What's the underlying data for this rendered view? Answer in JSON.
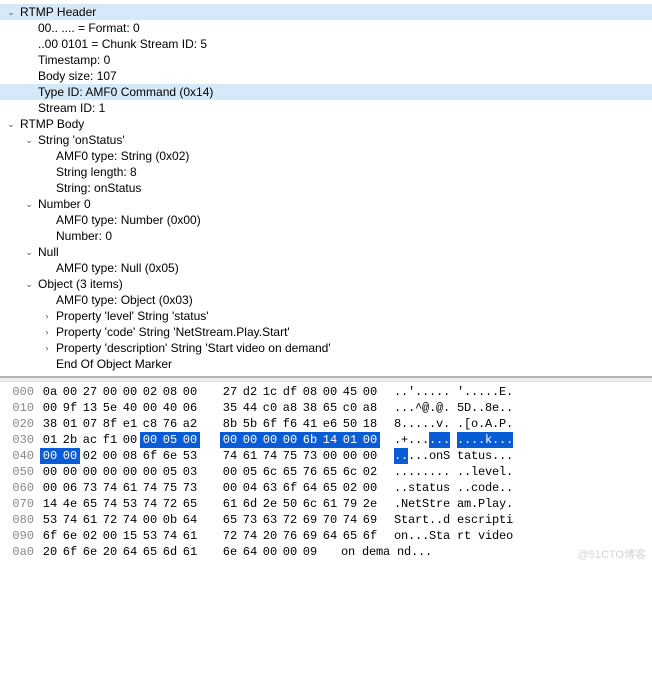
{
  "tree": [
    {
      "indent": 1,
      "caret": "v",
      "text": "RTMP Header",
      "sel": "header",
      "interact": true,
      "name": "rtmp-header-node"
    },
    {
      "indent": 2,
      "caret": "",
      "text": "00.. .... = Format: 0",
      "interact": true,
      "name": "format-field"
    },
    {
      "indent": 2,
      "caret": "",
      "text": "..00 0101 = Chunk Stream ID: 5",
      "interact": true,
      "name": "chunk-stream-id-field"
    },
    {
      "indent": 2,
      "caret": "",
      "text": "Timestamp: 0",
      "interact": true,
      "name": "timestamp-field"
    },
    {
      "indent": 2,
      "caret": "",
      "text": "Body size: 107",
      "interact": true,
      "name": "body-size-field"
    },
    {
      "indent": 2,
      "caret": "",
      "text": "Type ID: AMF0 Command (0x14)",
      "sel": "field",
      "interact": true,
      "name": "type-id-field"
    },
    {
      "indent": 2,
      "caret": "",
      "text": "Stream ID: 1",
      "interact": true,
      "name": "stream-id-field"
    },
    {
      "indent": 1,
      "caret": "v",
      "text": "RTMP Body",
      "interact": true,
      "name": "rtmp-body-node"
    },
    {
      "indent": 2,
      "caret": "v",
      "text": "String 'onStatus'",
      "interact": true,
      "name": "string-onstatus-node"
    },
    {
      "indent": 3,
      "caret": "",
      "text": "AMF0 type: String (0x02)",
      "interact": true,
      "name": "amf0-string-type"
    },
    {
      "indent": 3,
      "caret": "",
      "text": "String length: 8",
      "interact": true,
      "name": "string-length-field"
    },
    {
      "indent": 3,
      "caret": "",
      "text": "String: onStatus",
      "interact": true,
      "name": "string-value-field"
    },
    {
      "indent": 2,
      "caret": "v",
      "text": "Number 0",
      "interact": true,
      "name": "number-node"
    },
    {
      "indent": 3,
      "caret": "",
      "text": "AMF0 type: Number (0x00)",
      "interact": true,
      "name": "amf0-number-type"
    },
    {
      "indent": 3,
      "caret": "",
      "text": "Number: 0",
      "interact": true,
      "name": "number-value-field"
    },
    {
      "indent": 2,
      "caret": "v",
      "text": "Null",
      "interact": true,
      "name": "null-node"
    },
    {
      "indent": 3,
      "caret": "",
      "text": "AMF0 type: Null (0x05)",
      "interact": true,
      "name": "amf0-null-type"
    },
    {
      "indent": 2,
      "caret": "v",
      "text": "Object (3 items)",
      "interact": true,
      "name": "object-node"
    },
    {
      "indent": 3,
      "caret": "",
      "text": "AMF0 type: Object (0x03)",
      "interact": true,
      "name": "amf0-object-type"
    },
    {
      "indent": 3,
      "caret": ">",
      "text": "Property 'level' String 'status'",
      "interact": true,
      "name": "prop-level-node"
    },
    {
      "indent": 3,
      "caret": ">",
      "text": "Property 'code' String 'NetStream.Play.Start'",
      "interact": true,
      "name": "prop-code-node"
    },
    {
      "indent": 3,
      "caret": ">",
      "text": "Property 'description' String 'Start video on demand'",
      "interact": true,
      "name": "prop-description-node"
    },
    {
      "indent": 3,
      "caret": "",
      "text": "End Of Object Marker",
      "interact": true,
      "name": "end-of-object-field"
    }
  ],
  "hex": {
    "highlight": {
      "start": 53,
      "end": 65
    },
    "rows": [
      {
        "off": "000",
        "b": [
          "0a",
          "00",
          "27",
          "00",
          "00",
          "02",
          "08",
          "00",
          "27",
          "d2",
          "1c",
          "df",
          "08",
          "00",
          "45",
          "00"
        ],
        "a": "..'.....'.....E."
      },
      {
        "off": "010",
        "b": [
          "00",
          "9f",
          "13",
          "5e",
          "40",
          "00",
          "40",
          "06",
          "35",
          "44",
          "c0",
          "a8",
          "38",
          "65",
          "c0",
          "a8"
        ],
        "a": "...^@.@.5D..8e.."
      },
      {
        "off": "020",
        "b": [
          "38",
          "01",
          "07",
          "8f",
          "e1",
          "c8",
          "76",
          "a2",
          "8b",
          "5b",
          "6f",
          "f6",
          "41",
          "e6",
          "50",
          "18"
        ],
        "a": "8.....v..[o.A.P."
      },
      {
        "off": "030",
        "b": [
          "01",
          "2b",
          "ac",
          "f1",
          "00",
          "00",
          "05",
          "00",
          "00",
          "00",
          "00",
          "00",
          "6b",
          "14",
          "01",
          "00"
        ],
        "a": ".+..........k..."
      },
      {
        "off": "040",
        "b": [
          "00",
          "00",
          "02",
          "00",
          "08",
          "6f",
          "6e",
          "53",
          "74",
          "61",
          "74",
          "75",
          "73",
          "00",
          "00",
          "00"
        ],
        "a": ".....onStatus..."
      },
      {
        "off": "050",
        "b": [
          "00",
          "00",
          "00",
          "00",
          "00",
          "00",
          "05",
          "03",
          "00",
          "05",
          "6c",
          "65",
          "76",
          "65",
          "6c",
          "02"
        ],
        "a": "..........level."
      },
      {
        "off": "060",
        "b": [
          "00",
          "06",
          "73",
          "74",
          "61",
          "74",
          "75",
          "73",
          "00",
          "04",
          "63",
          "6f",
          "64",
          "65",
          "02",
          "00"
        ],
        "a": "..status..code.."
      },
      {
        "off": "070",
        "b": [
          "14",
          "4e",
          "65",
          "74",
          "53",
          "74",
          "72",
          "65",
          "61",
          "6d",
          "2e",
          "50",
          "6c",
          "61",
          "79",
          "2e"
        ],
        "a": ".NetStream.Play."
      },
      {
        "off": "080",
        "b": [
          "53",
          "74",
          "61",
          "72",
          "74",
          "00",
          "0b",
          "64",
          "65",
          "73",
          "63",
          "72",
          "69",
          "70",
          "74",
          "69"
        ],
        "a": "Start..descripti"
      },
      {
        "off": "090",
        "b": [
          "6f",
          "6e",
          "02",
          "00",
          "15",
          "53",
          "74",
          "61",
          "72",
          "74",
          "20",
          "76",
          "69",
          "64",
          "65",
          "6f"
        ],
        "a": "on...Start video"
      },
      {
        "off": "0a0",
        "b": [
          "20",
          "6f",
          "6e",
          "20",
          "64",
          "65",
          "6d",
          "61",
          "6e",
          "64",
          "00",
          "00",
          "09"
        ],
        "a": " on demand..."
      }
    ]
  },
  "watermark": "@51CTO博客"
}
